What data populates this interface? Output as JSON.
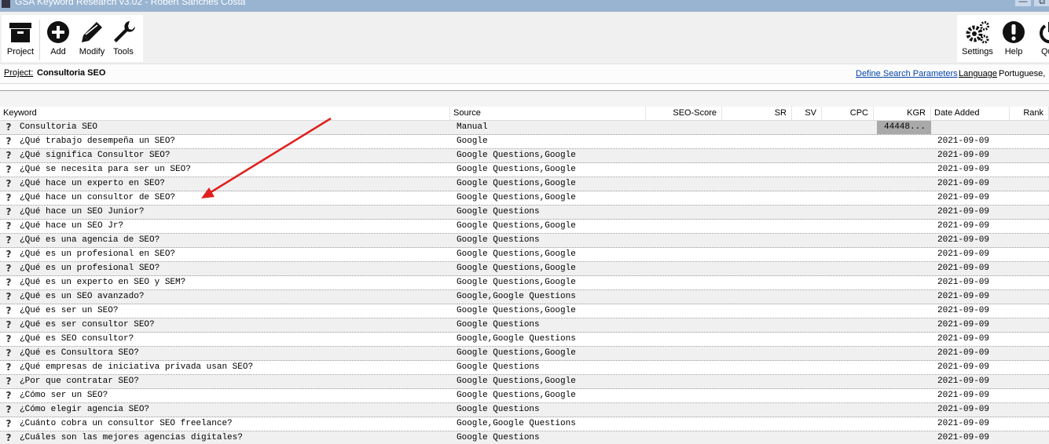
{
  "window": {
    "title": "GSA Keyword Research v3.02 - Robert Sanches Costa",
    "minimize_glyph": "—",
    "maximize_glyph": "⧉"
  },
  "toolbar": {
    "left": [
      {
        "label": "Project",
        "icon": "archive-box-icon"
      },
      {
        "label": "Add",
        "icon": "plus-circle-icon"
      },
      {
        "label": "Modify",
        "icon": "pencil-icon"
      },
      {
        "label": "Tools",
        "icon": "wrench-icon"
      }
    ],
    "right": [
      {
        "label": "Settings",
        "icon": "gears-icon"
      },
      {
        "label": "Help",
        "icon": "exclamation-circle-icon"
      },
      {
        "label": "Qu",
        "icon": "power-icon"
      }
    ]
  },
  "project_bar": {
    "project_label": "Project:",
    "project_name": "Consultoria SEO",
    "define_search_parameters": "Define Search Parameters",
    "language_label": "Language",
    "language_value": "Portuguese,"
  },
  "table": {
    "columns": [
      "Keyword",
      "Source",
      "SEO-Score",
      "SR",
      "SV",
      "CPC",
      "KGR",
      "Date Added",
      "Rank"
    ],
    "rows": [
      {
        "keyword": "Consultoria SEO",
        "source": "Manual",
        "kgr": "44448...",
        "date": ""
      },
      {
        "keyword": "¿Qué trabajo desempeña un SEO?",
        "source": "Google",
        "kgr": "",
        "date": "2021-09-09"
      },
      {
        "keyword": "¿Qué significa Consultor SEO?",
        "source": "Google Questions,Google",
        "kgr": "",
        "date": "2021-09-09"
      },
      {
        "keyword": "¿Qué se necesita para ser un SEO?",
        "source": "Google Questions,Google",
        "kgr": "",
        "date": "2021-09-09"
      },
      {
        "keyword": "¿Qué hace un experto en SEO?",
        "source": "Google Questions,Google",
        "kgr": "",
        "date": "2021-09-09"
      },
      {
        "keyword": "¿Qué hace un consultor de SEO?",
        "source": "Google Questions,Google",
        "kgr": "",
        "date": "2021-09-09"
      },
      {
        "keyword": "¿Qué hace un SEO Junior?",
        "source": "Google Questions",
        "kgr": "",
        "date": "2021-09-09"
      },
      {
        "keyword": "¿Qué hace un SEO Jr?",
        "source": "Google Questions,Google",
        "kgr": "",
        "date": "2021-09-09"
      },
      {
        "keyword": "¿Qué es una agencia de SEO?",
        "source": "Google Questions",
        "kgr": "",
        "date": "2021-09-09"
      },
      {
        "keyword": "¿Qué es un profesional en SEO?",
        "source": "Google Questions,Google",
        "kgr": "",
        "date": "2021-09-09"
      },
      {
        "keyword": "¿Qué es un profesional SEO?",
        "source": "Google Questions,Google",
        "kgr": "",
        "date": "2021-09-09"
      },
      {
        "keyword": "¿Qué es un experto en SEO y SEM?",
        "source": "Google Questions,Google",
        "kgr": "",
        "date": "2021-09-09"
      },
      {
        "keyword": "¿Qué es un SEO avanzado?",
        "source": "Google,Google Questions",
        "kgr": "",
        "date": "2021-09-09"
      },
      {
        "keyword": "¿Qué es ser un SEO?",
        "source": "Google Questions,Google",
        "kgr": "",
        "date": "2021-09-09"
      },
      {
        "keyword": "¿Qué es ser consultor SEO?",
        "source": "Google Questions",
        "kgr": "",
        "date": "2021-09-09"
      },
      {
        "keyword": "¿Qué es SEO consultor?",
        "source": "Google,Google Questions",
        "kgr": "",
        "date": "2021-09-09"
      },
      {
        "keyword": "¿Qué es Consultora SEO?",
        "source": "Google Questions,Google",
        "kgr": "",
        "date": "2021-09-09"
      },
      {
        "keyword": "¿Qué empresas de iniciativa privada usan SEO?",
        "source": "Google Questions",
        "kgr": "",
        "date": "2021-09-09"
      },
      {
        "keyword": "¿Por que contratar SEO?",
        "source": "Google Questions,Google",
        "kgr": "",
        "date": "2021-09-09"
      },
      {
        "keyword": "¿Cómo ser un SEO?",
        "source": "Google Questions,Google",
        "kgr": "",
        "date": "2021-09-09"
      },
      {
        "keyword": "¿Cómo elegir agencia SEO?",
        "source": "Google Questions",
        "kgr": "",
        "date": "2021-09-09"
      },
      {
        "keyword": "¿Cuánto cobra un consultor SEO freelance?",
        "source": "Google,Google Questions",
        "kgr": "",
        "date": "2021-09-09"
      },
      {
        "keyword": "¿Cuáles son las mejores agencias digitales?",
        "source": "Google Questions",
        "kgr": "",
        "date": "2021-09-09"
      }
    ]
  },
  "annotation": {
    "arrow_color": "#e0201e"
  }
}
